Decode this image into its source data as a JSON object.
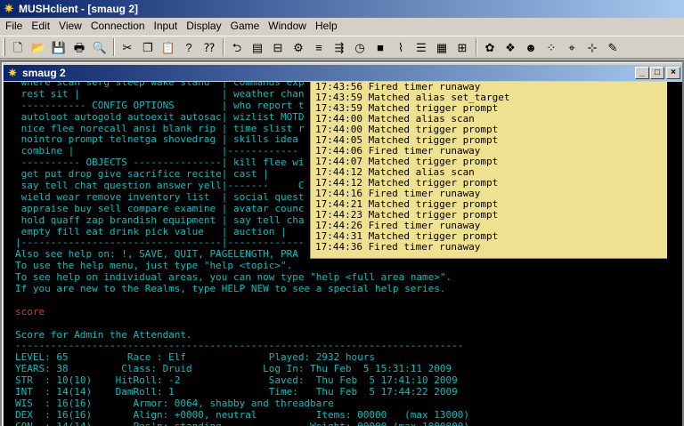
{
  "app": {
    "title": "MUSHclient - [smaug 2]"
  },
  "menu": [
    "File",
    "Edit",
    "View",
    "Connection",
    "Input",
    "Display",
    "Game",
    "Window",
    "Help"
  ],
  "toolbar": {
    "groups": [
      [
        "new-icon",
        "open-icon",
        "save-icon",
        "print-icon",
        "print-preview-icon"
      ],
      [
        "cut-icon",
        "copy-icon",
        "paste-icon",
        "help-icon",
        "context-help-icon"
      ],
      [
        "connect-icon",
        "notepad-icon",
        "log-icon",
        "world-config-icon",
        "aliases-icon",
        "triggers-icon",
        "timers-icon",
        "output-icon",
        "command-history-icon",
        "activity-list-icon",
        "text-attributes-icon",
        "reset-all-timers-icon"
      ],
      [
        "plugins-icon",
        "package-icon",
        "mapper-icon",
        "footprint-icon",
        "find-icon",
        "find-again-icon",
        "edit-icon"
      ]
    ]
  },
  "child": {
    "title": "smaug 2"
  },
  "output_lines": [
    {
      "t": " where scan serg sleep wake stand  | commands exp",
      "c": "cyan"
    },
    {
      "t": " rest sit |                        | weather chan",
      "c": "cyan"
    },
    {
      "t": " ----------- CONFIG OPTIONS        | who report t",
      "c": "cyan"
    },
    {
      "t": " autoloot autogold autoexit autosac| wizlist MOTD",
      "c": "cyan"
    },
    {
      "t": " nice flee norecall ansi blank rip | time slist r",
      "c": "cyan"
    },
    {
      "t": " nointro prompt telnetga shovedrag | skills idea ",
      "c": "cyan"
    },
    {
      "t": " combine |                         |------------",
      "c": "cyan"
    },
    {
      "t": " ---------- OBJECTS ---------------| kill flee wi",
      "c": "cyan"
    },
    {
      "t": " get put drop give sacrifice recite| cast |      ",
      "c": "cyan"
    },
    {
      "t": " say tell chat question answer yell|-------     C",
      "c": "cyan"
    },
    {
      "t": " wield wear remove inventory list  | social quest",
      "c": "cyan"
    },
    {
      "t": " appraise buy sell compare examine | avatar counc",
      "c": "cyan"
    },
    {
      "t": " hold quaff zap brandish equipment | say tell cha",
      "c": "cyan"
    },
    {
      "t": " empty fill eat drink pick value   | auction |   ",
      "c": "cyan"
    },
    {
      "t": "|----------------------------------|-------------",
      "c": "cyan"
    },
    {
      "t": "Also see help on: !, SAVE, QUIT, PAGELENGTH, PRA",
      "c": "cyan"
    },
    {
      "t": "To use the help menu, just type \"help <topic>\".",
      "c": "cyan"
    },
    {
      "t": "To see help on individual areas, you can now type \"help <full area name>\".",
      "c": "cyan"
    },
    {
      "t": "If you are new to the Realms, type HELP NEW to see a special help series.",
      "c": "cyan"
    },
    {
      "t": "",
      "c": "cyan"
    },
    {
      "t": "score",
      "c": "red"
    },
    {
      "t": "",
      "c": "cyan"
    },
    {
      "t": "Score for Admin the Attendant.",
      "c": "cyan"
    },
    {
      "t": "----------------------------------------------------------------------------",
      "c": "cyan"
    },
    {
      "t": "LEVEL: 65          Race : Elf              Played: 2932 hours",
      "c": "cyan"
    },
    {
      "t": "YEARS: 38         Class: Druid            Log In: Thu Feb  5 15:31:11 2009",
      "c": "cyan"
    },
    {
      "t": "STR  : 10(10)    HitRoll: -2               Saved:  Thu Feb  5 17:41:10 2009",
      "c": "cyan"
    },
    {
      "t": "INT  : 14(14)    DamRoll: 1                Time:   Thu Feb  5 17:44:22 2009",
      "c": "cyan"
    },
    {
      "t": "WIS  : 16(16)       Armor: 0064, shabby and threadbare",
      "c": "cyan"
    },
    {
      "t": "DEX  : 16(16)       Align: +0000, neutral          Items: 00000   (max 13000)",
      "c": "cyan"
    },
    {
      "t": "CON  : 14(14)       Pos'n: standing               Weight: 00000 (max 1000000)",
      "c": "cyan"
    }
  ],
  "info_lines": [
    "17:43:56 Fired timer runaway",
    "17:43:59 Matched alias set_target",
    "17:43:59 Matched trigger prompt",
    "17:44:00 Matched alias scan",
    "17:44:00 Matched trigger prompt",
    "17:44:05 Matched trigger prompt",
    "17:44:06 Fired timer runaway",
    "17:44:07 Matched trigger prompt",
    "17:44:12 Matched alias scan",
    "17:44:12 Matched trigger prompt",
    "17:44:16 Fired timer runaway",
    "17:44:21 Matched trigger prompt",
    "17:44:23 Matched trigger prompt",
    "17:44:26 Fired timer runaway",
    "17:44:31 Matched trigger prompt",
    "17:44:36 Fired timer runaway"
  ],
  "colors": {
    "output_text": "#00c0c0",
    "command_echo": "#c04040",
    "info_bg": "#eee190",
    "titlebar": "#0a246a"
  }
}
